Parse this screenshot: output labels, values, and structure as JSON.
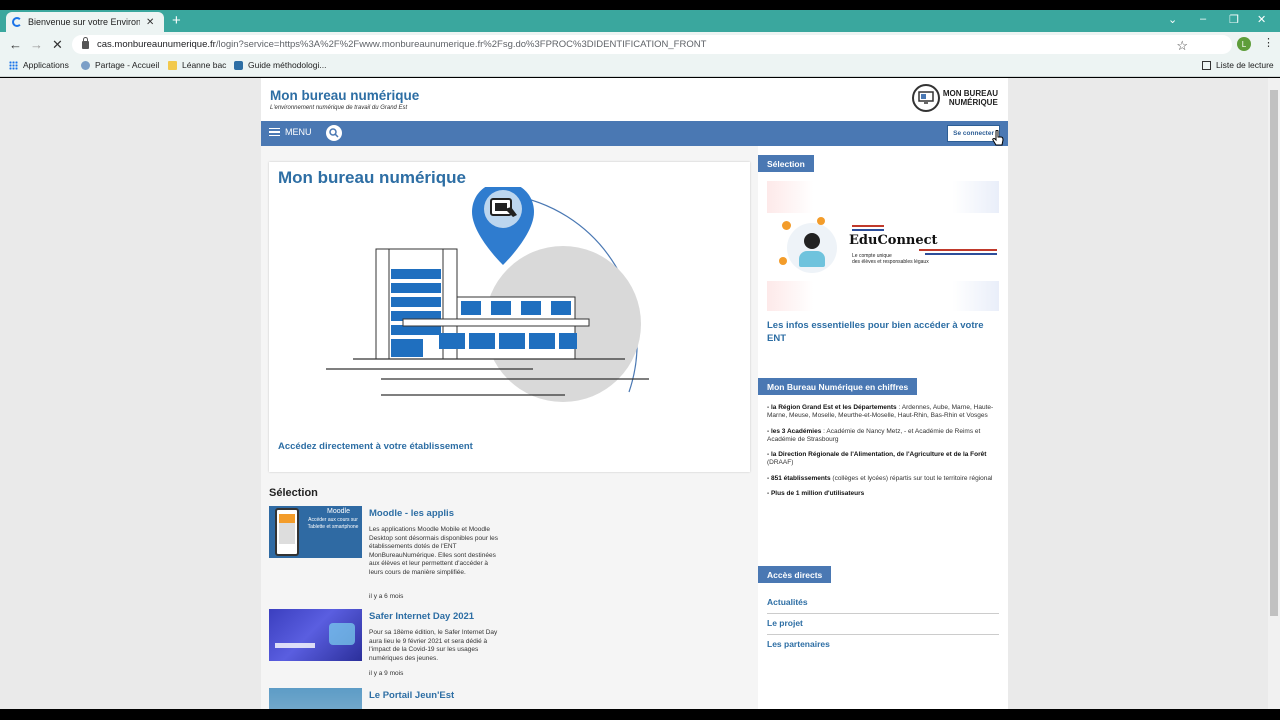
{
  "browser": {
    "tab_title": "Bienvenue sur votre Environnem…",
    "tab_close": "✕",
    "new_tab": "+",
    "url_domain": "cas.monbureaunumerique.fr",
    "url_path": "/login?service=https%3A%2F%2Fwww.monbureaunumerique.fr%2Fsg.do%3FPROC%3DIDENTIFICATION_FRONT",
    "profile_initial": "L",
    "bookmarks": [
      "Applications",
      "Partage - Accueil",
      "Léanne bac",
      "Guide méthodologi..."
    ],
    "reading_list": "Liste de lecture"
  },
  "site": {
    "title": "Mon bureau numérique",
    "tagline": "L'environnement numérique de travail du Grand Est",
    "logo_line1": "MON BUREAU",
    "logo_line2": "NUMÉRIQUE",
    "menu_label": "MENU",
    "login_label": "Se connecter"
  },
  "hero": {
    "title": "Mon bureau numérique",
    "link": "Accédez directement à votre établissement"
  },
  "selection": {
    "heading": "Sélection",
    "items": [
      {
        "title": "Moodle - les applis",
        "description": "Les applications Moodle Mobile et Moodle Desktop sont désormais disponibles pour les établissements dotés de l'ENT MonBureauNumérique. Elles sont destinées aux élèves et leur permettent d'accéder à leurs cours de manière simplifiée.",
        "date": "il y a 6 mois",
        "thumb_title": "Moodle",
        "thumb_text": "Accéder aux cours sur Tablette et smartphone"
      },
      {
        "title": "Safer Internet Day 2021",
        "description": "Pour sa 18ème édition, le Safer Internet Day aura lieu le 9 février 2021 et sera dédié à l'impact de la Covid-19 sur les usages numériques des jeunes.",
        "date": "il y a 9 mois"
      },
      {
        "title": "Le Portail Jeun'Est",
        "description": "",
        "date": ""
      }
    ]
  },
  "sidebar": {
    "selection_tag": "Sélection",
    "educonnect_name": "EduConnect",
    "educonnect_sub1": "Le compte unique",
    "educonnect_sub2": "des élèves et responsables légaux",
    "educonnect_link": "Les infos essentielles pour bien accéder à votre ENT",
    "figures_tag": "Mon Bureau Numérique en chiffres",
    "stats": [
      {
        "bold": "- la Région Grand Est et les Départements",
        "text": " : Ardennes, Aube, Marne, Haute-Marne, Meuse, Moselle, Meurthe-et-Moselle, Haut-Rhin, Bas-Rhin et Vosges"
      },
      {
        "bold": "- les 3 Académies",
        "text": " : Académie de Nancy Metz, - et Académie de Reims et Académie de Strasbourg"
      },
      {
        "bold": "- la Direction Régionale de l'Alimentation, de l'Agriculture et de la Forêt",
        "text": " (DRAAF)"
      },
      {
        "bold": "- 851 établissements",
        "text": " (collèges et lycées) répartis sur tout le territoire régional"
      },
      {
        "bold": "- Plus de 1 million d'utilisateurs",
        "text": ""
      }
    ],
    "direct_tag": "Accès directs",
    "direct_links": [
      "Actualités",
      "Le projet",
      "Les partenaires"
    ]
  }
}
